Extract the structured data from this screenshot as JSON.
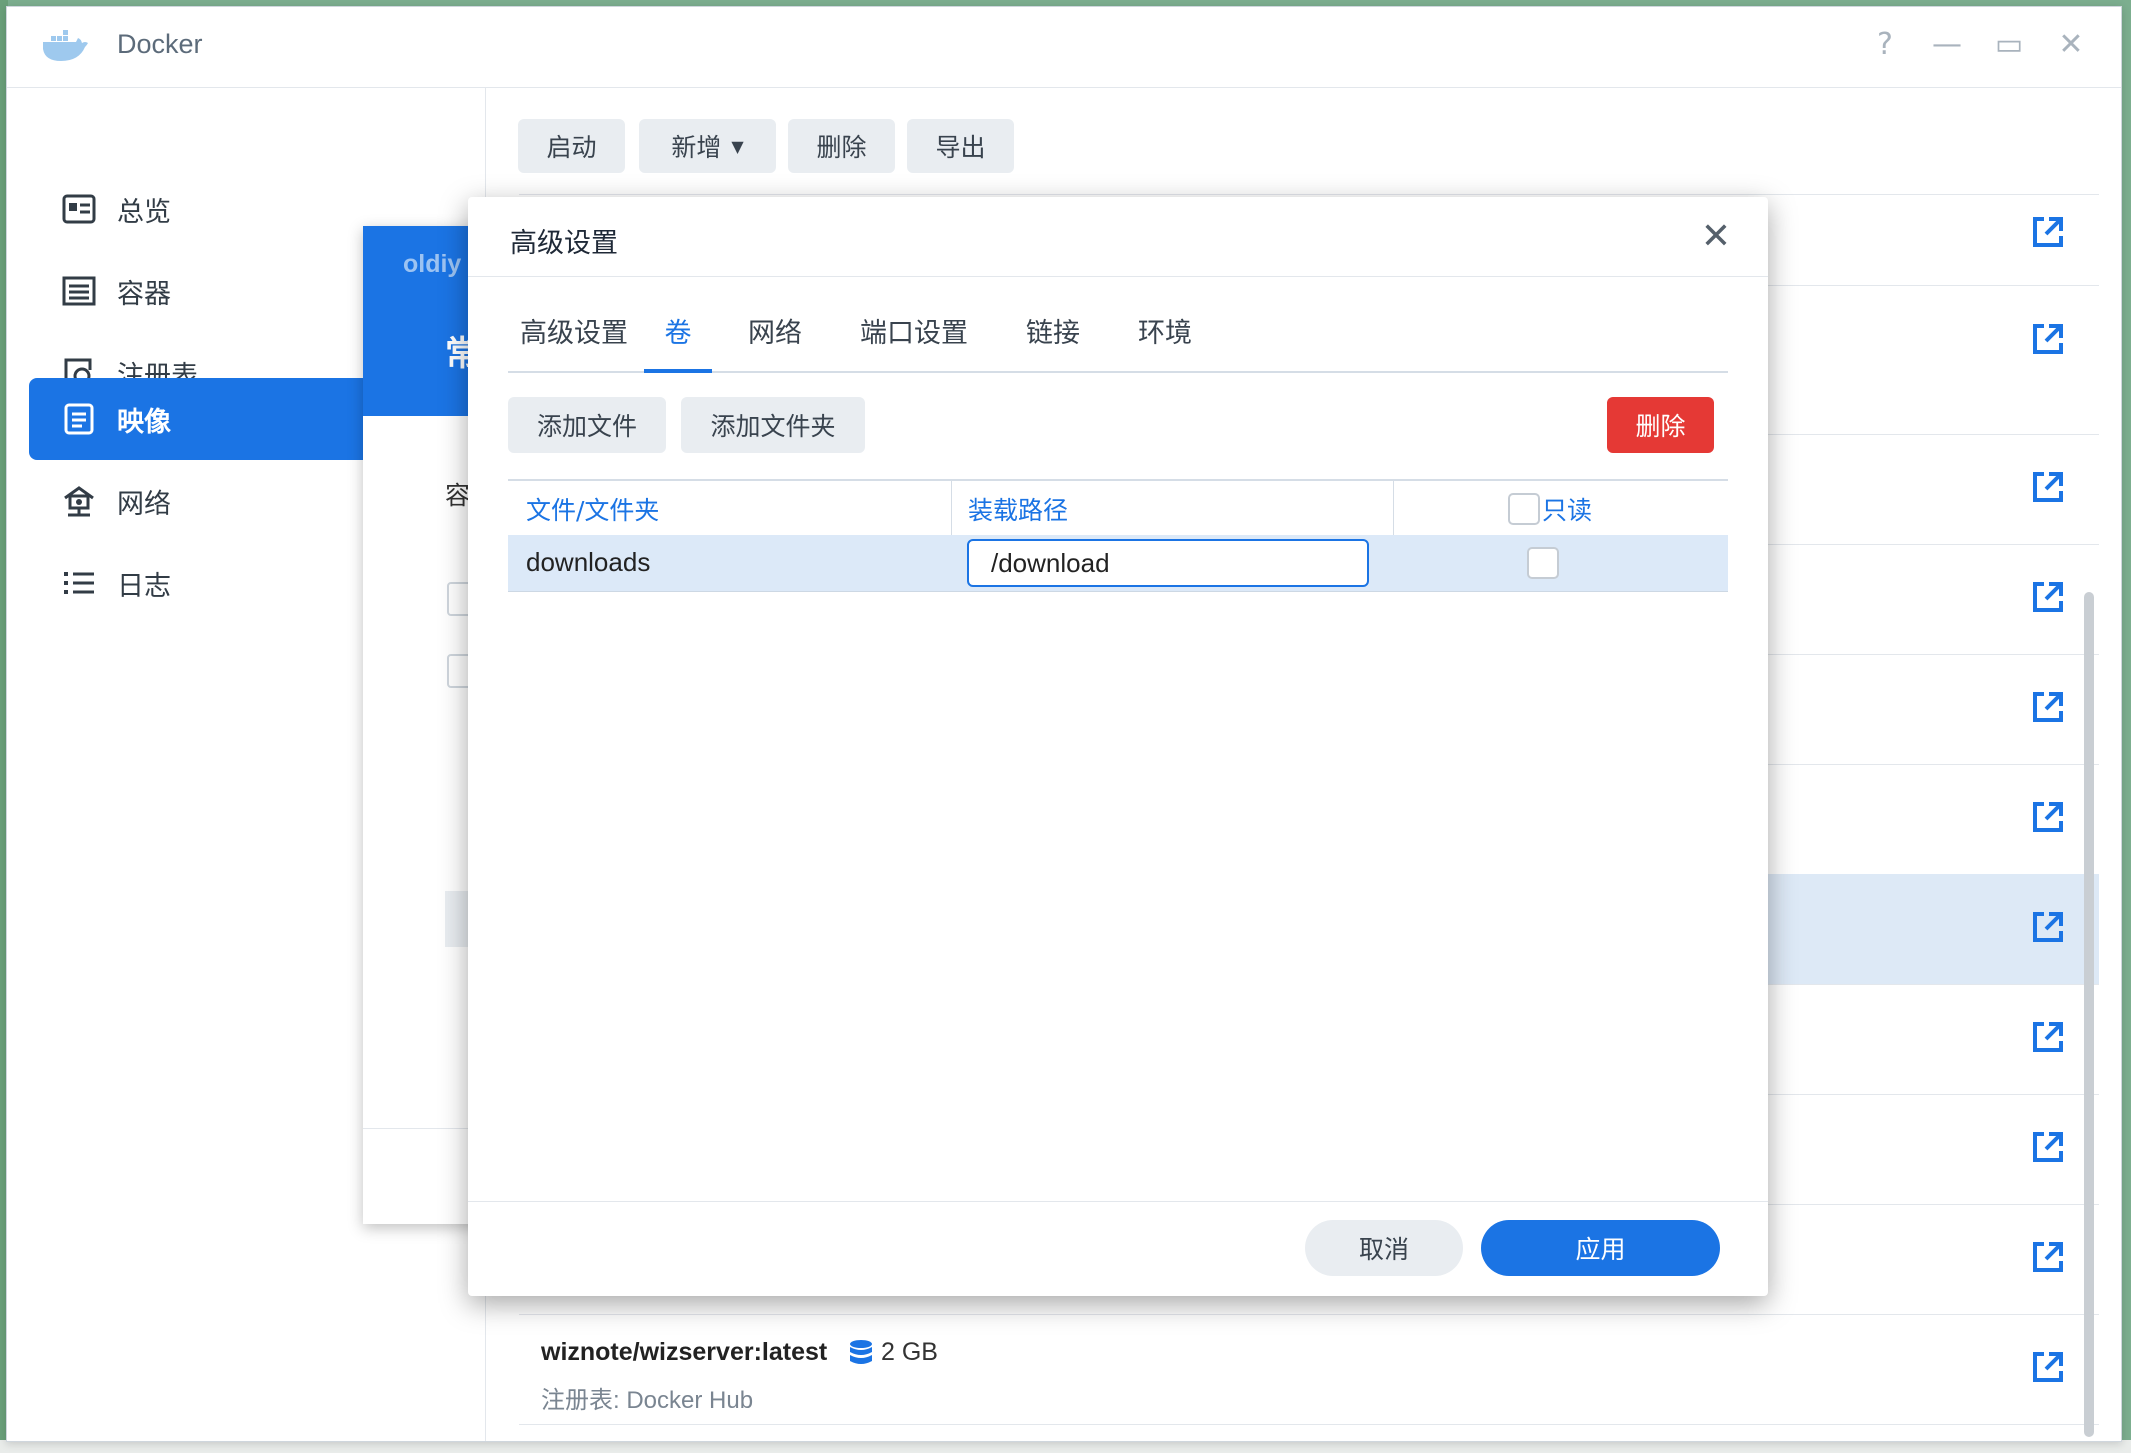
{
  "window": {
    "title": "Docker",
    "controls": [
      "?",
      "—",
      "▭",
      "✕"
    ]
  },
  "sidebar": {
    "items": [
      {
        "label": "总览",
        "icon": "overview-icon"
      },
      {
        "label": "容器",
        "icon": "container-icon"
      },
      {
        "label": "注册表",
        "icon": "registry-icon"
      },
      {
        "label": "映像",
        "icon": "image-icon",
        "active": true
      },
      {
        "label": "网络",
        "icon": "network-icon"
      },
      {
        "label": "日志",
        "icon": "log-icon"
      }
    ]
  },
  "toolbar": {
    "start": "启动",
    "add": "新增",
    "delete": "删除",
    "export": "导出"
  },
  "image_list": {
    "last_item": {
      "name": "wiznote/wizserver:latest",
      "size": "2 GB",
      "registry": "注册表: Docker Hub"
    }
  },
  "wizard": {
    "header_text": "oldiy",
    "header_title": "常",
    "label": "容"
  },
  "dialog": {
    "title": "高级设置",
    "close": "✕",
    "tabs": [
      "高级设置",
      "卷",
      "网络",
      "端口设置",
      "链接",
      "环境"
    ],
    "active_tab": "卷",
    "buttons": {
      "add_file": "添加文件",
      "add_folder": "添加文件夹",
      "delete": "删除"
    },
    "table": {
      "headers": [
        "文件/文件夹",
        "装载路径",
        "只读"
      ],
      "rows": [
        {
          "file": "downloads",
          "mount_path": "/download",
          "readonly": false
        }
      ]
    },
    "footer": {
      "cancel": "取消",
      "apply": "应用"
    }
  },
  "colors": {
    "accent": "#1b74e4",
    "danger": "#e53935",
    "selected_row": "#dce9f6"
  }
}
